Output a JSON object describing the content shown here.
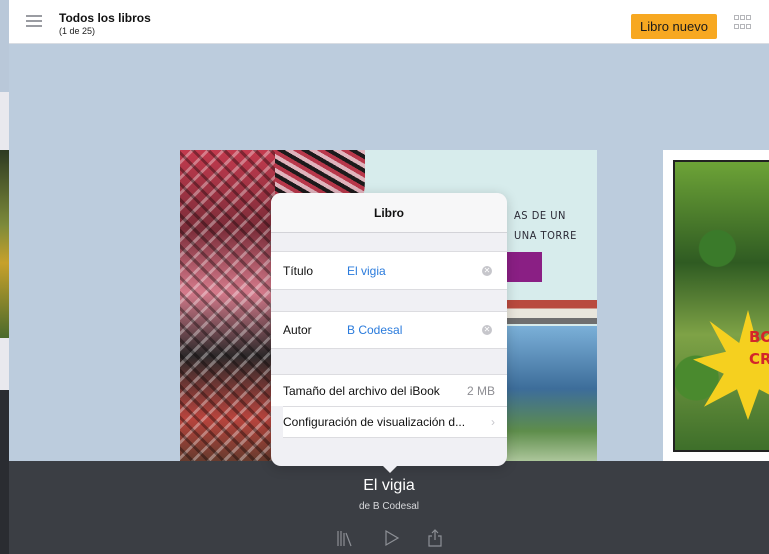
{
  "header": {
    "title": "Todos los libros",
    "subtitle": "(1 de 25)",
    "new_book_label": "Libro nuevo"
  },
  "books": {
    "current_cover_title_line1": "AS DE UN",
    "current_cover_title_line2": "UNA TORRE",
    "next_cover_text_line1": "BO",
    "next_cover_text_line2": "CREA"
  },
  "popover": {
    "title": "Libro",
    "title_label": "Título",
    "title_value": "El vigia",
    "author_label": "Autor",
    "author_value": "B Codesal",
    "file_size_label": "Tamaño del archivo del iBook",
    "file_size_value": "2 MB",
    "display_settings_label": "Configuración de visualización d..."
  },
  "bottom_bar": {
    "book_title": "El vigia",
    "book_author": "de B Codesal"
  },
  "icons": {
    "menu": "menu-icon",
    "grid": "grid-view-icon",
    "library": "library-icon",
    "play": "play-icon",
    "share": "share-icon",
    "clear": "clear-icon",
    "chevron": "chevron-right-icon"
  },
  "colors": {
    "accent_button": "#f7a821",
    "link_blue": "#2a7bdc",
    "background": "#bcccdd",
    "bottom_bar": "#3b3e44"
  }
}
